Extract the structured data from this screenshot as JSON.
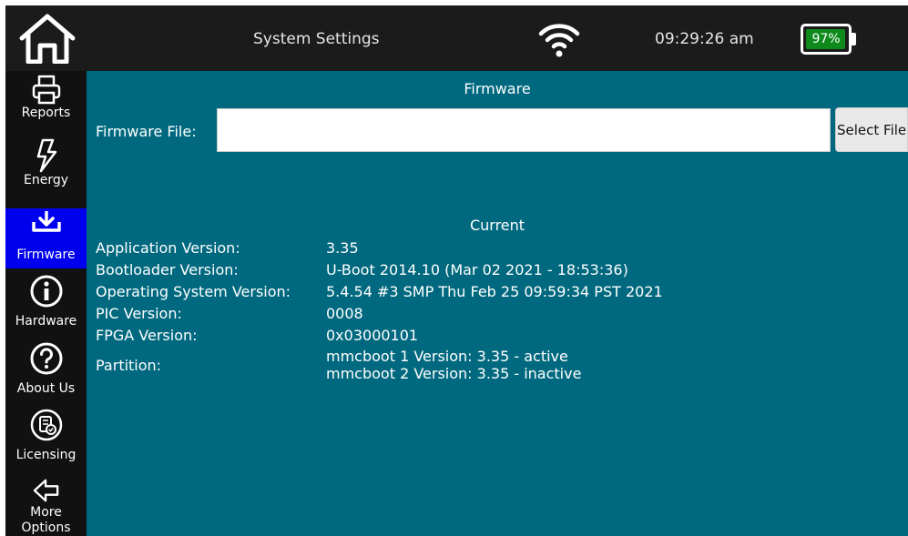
{
  "header": {
    "title": "System Settings",
    "time": "09:29:26 am",
    "battery": {
      "label": "97%",
      "level": 0.97,
      "color": "#0e8a1d"
    },
    "icons": {
      "home": "home-icon",
      "wifi": "wifi-icon"
    }
  },
  "sidebar": {
    "items": [
      {
        "label": "Reports",
        "icon": "printer-icon"
      },
      {
        "label": "Energy",
        "icon": "lightning-icon"
      },
      {
        "label": "Firmware",
        "icon": "download-icon",
        "active": true
      },
      {
        "label": "Hardware",
        "icon": "info-icon"
      },
      {
        "label": "About Us",
        "icon": "question-icon"
      },
      {
        "label": "Licensing",
        "icon": "license-icon"
      },
      {
        "label": "More Options",
        "icon": "arrow-left-icon"
      }
    ]
  },
  "firmware": {
    "heading": "Firmware",
    "file_label": "Firmware File:",
    "file_value": "",
    "select_button": "Select File"
  },
  "current": {
    "heading": "Current",
    "rows": [
      {
        "key": "Application Version:",
        "value": "3.35"
      },
      {
        "key": "Bootloader Version:",
        "value": "U-Boot 2014.10 (Mar 02 2021 - 18:53:36)"
      },
      {
        "key": "Operating System Version:",
        "value": "5.4.54 #3 SMP Thu Feb 25 09:59:34 PST 2021"
      },
      {
        "key": "PIC Version:",
        "value": "0008"
      },
      {
        "key": "FPGA Version:",
        "value": "0x03000101"
      }
    ],
    "partition": {
      "key": "Partition:",
      "lines": [
        "mmcboot 1 Version:  3.35 - active",
        "mmcboot 2 Version:  3.35 - inactive"
      ]
    }
  },
  "colors": {
    "content_bg": "#01697f",
    "active_nav": "#0000ee",
    "bar_bg": "#1b1b1b"
  }
}
